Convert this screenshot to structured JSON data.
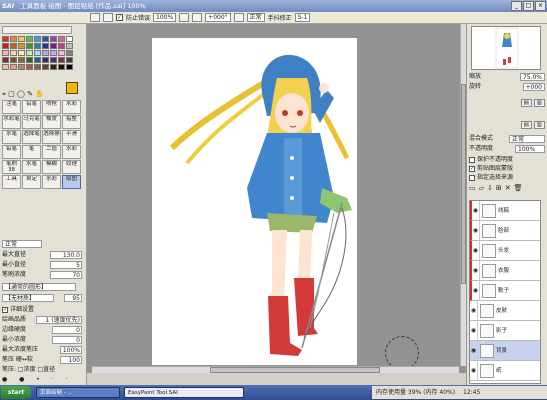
{
  "window": {
    "app_logo": "SAI",
    "title": "工具面板 绘图 - 图层贴纸 [作品.sai] 100%",
    "minimize": "_",
    "maximize": "□",
    "close": "×"
  },
  "toolbar": {
    "zoom_value": "100%",
    "angle_value": "+000°",
    "stabilizer_label": "手抖修正",
    "stabilizer_value": "S-1",
    "mode_label": "正常",
    "check_label": "防止错误"
  },
  "left_panel": {
    "swatch_colors": [
      "#e03030",
      "#f08030",
      "#f0d030",
      "#60c040",
      "#30a0e0",
      "#3050c0",
      "#9040c0",
      "#e060a0",
      "#ffffff",
      "#c02020",
      "#c06020",
      "#c0a020",
      "#409030",
      "#2080c0",
      "#203090",
      "#702090",
      "#c04080",
      "#c0c0c0",
      "#ffb0b0",
      "#ffd0a0",
      "#fff0a0",
      "#c0f0a0",
      "#a0e0ff",
      "#a0b0ff",
      "#d0a0ff",
      "#ffb0e0",
      "#808080",
      "#7a3030",
      "#7a5030",
      "#7a7030",
      "#306030",
      "#305a7a",
      "#30305a",
      "#503060",
      "#7a3050",
      "#404040",
      "#f0c0a0",
      "#e0a080",
      "#c08060",
      "#a06040",
      "#806040",
      "#604030",
      "#402010",
      "#201008",
      "#000000"
    ],
    "fg_color": "#f5b800",
    "tools": [
      {
        "label": "注笔",
        "sel": false
      },
      {
        "label": "铅笔",
        "sel": false
      },
      {
        "label": "喷枪",
        "sel": false
      },
      {
        "label": "水彩",
        "sel": false
      },
      {
        "label": "水彩笔",
        "sel": false
      },
      {
        "label": "马克笔",
        "sel": false
      },
      {
        "label": "橡皮",
        "sel": false
      },
      {
        "label": "指整",
        "sel": false
      },
      {
        "label": "水笔",
        "sel": false
      },
      {
        "label": "选择笔",
        "sel": false
      },
      {
        "label": "选择擦",
        "sel": false
      },
      {
        "label": "平滑",
        "sel": false
      },
      {
        "label": "铅笔",
        "sel": false
      },
      {
        "label": "笔",
        "sel": false
      },
      {
        "label": "二值",
        "sel": false
      },
      {
        "label": "水彩",
        "sel": false
      },
      {
        "label": "笔刷38",
        "sel": false
      },
      {
        "label": "水笔",
        "sel": false
      },
      {
        "label": "模糊",
        "sel": false
      },
      {
        "label": "纹理",
        "sel": false
      },
      {
        "label": "工具",
        "sel": false
      },
      {
        "label": "自定",
        "sel": false
      },
      {
        "label": "水彩",
        "sel": false
      },
      {
        "label": "绘图",
        "sel": true
      }
    ],
    "mode_label": "正常",
    "max_size_label": "最大直径",
    "max_size_value": "130.0",
    "min_size_label": "最小直径",
    "min_size_value": "5",
    "density_label": "笔刷浓度",
    "density_value": "70",
    "shape_label": "【通常的圆形】",
    "texture_label": "【无材质】",
    "texture_value": "95",
    "detail_check": "详细设置",
    "quality_label": "绘画品质",
    "quality_value": "1 (速度优先)",
    "edge_label": "边缘硬度",
    "edge_value": "0",
    "min_density_label": "最小浓度",
    "min_density_value": "0",
    "pressure_label": "最大浓度笔压",
    "pressure_value": "100%",
    "hardness_label": "笔压 硬↔软",
    "hardness_value": "100",
    "pressure_check_label": "笔压: □浓度 □直径"
  },
  "canvas": {
    "zoom_label": "100%"
  },
  "right_panel": {
    "zoom_label": "缩放",
    "zoom_value": "75.0%",
    "angle_label": "旋转",
    "angle_value": "+000",
    "blend_label": "混合模式",
    "blend_value": "正常",
    "opacity_label": "不透明度",
    "opacity_value": "100%",
    "check_protect": "保护不透明度",
    "check_clip": "剪贴图层蒙版",
    "check_select": "指定选择来源",
    "layers": [
      {
        "eye": "◉",
        "name": "线稿",
        "red": true,
        "sel": false
      },
      {
        "eye": "◉",
        "name": "脸部",
        "red": true,
        "sel": false
      },
      {
        "eye": "◉",
        "name": "头发",
        "red": true,
        "sel": false
      },
      {
        "eye": "◉",
        "name": "衣服",
        "red": true,
        "sel": false
      },
      {
        "eye": "◉",
        "name": "靴子",
        "red": true,
        "sel": false
      },
      {
        "eye": "◉",
        "name": "皮肤",
        "red": false,
        "sel": false
      },
      {
        "eye": "◉",
        "name": "影子",
        "red": false,
        "sel": false
      },
      {
        "eye": "◉",
        "name": "背景",
        "red": false,
        "sel": true
      },
      {
        "eye": "◉",
        "name": "纸",
        "red": false,
        "sel": false
      }
    ]
  },
  "status": {
    "memory": "内存使用量 39% (内存 40%)",
    "clock": "12:45"
  },
  "taskbar": {
    "start": "start",
    "tasks": [
      {
        "label": "页面绘制 - ...",
        "active": false
      },
      {
        "label": "EasyPaint Tool SAI",
        "active": true
      }
    ]
  }
}
